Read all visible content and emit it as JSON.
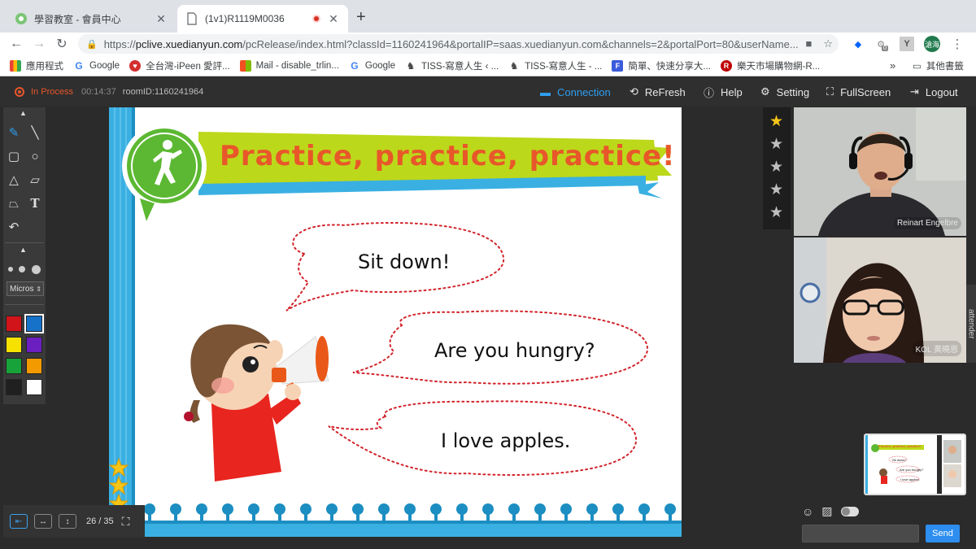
{
  "browser": {
    "tabs": [
      {
        "title": "學習教室 - 會員中心",
        "active": false
      },
      {
        "title": "(1v1)R1119M0036",
        "active": true
      }
    ],
    "url_host": "pclive.xuedianyun.com",
    "url_rest": "/pcRelease/index.html?classId=1160241964&portalIP=saas.xuedianyun.com&channels=2&portalPort=80&userName...",
    "url_scheme": "https://",
    "bookmarks": [
      "應用程式",
      "Google",
      "全台灣-iPeen 愛評...",
      "Mail - disable_trlin...",
      "Google",
      "TISS-寫意人生 ‹ ...",
      "TISS-寫意人生 - ...",
      "簡單、快速分享大...",
      "樂天市場購物網-R..."
    ],
    "bookmarks_more": "»",
    "other_bookmarks": "其他書籤",
    "profile_initials": "滄海",
    "ext_badge": "0"
  },
  "header": {
    "status": "In Process",
    "timer": "00:14:37",
    "room": "roomID:1160241964",
    "connection": "Connection",
    "refresh": "ReFresh",
    "help": "Help",
    "setting": "Setting",
    "fullscreen": "FullScreen",
    "logout": "Logout"
  },
  "toolbar": {
    "font": "Micros",
    "colors": [
      "#d0141a",
      "#1672c9",
      "#f7e100",
      "#6c1fc1",
      "#18a33a",
      "#f39a00",
      "#202020",
      "#ffffff"
    ],
    "selected_color": "#1672c9"
  },
  "slide": {
    "title": "Practice, practice, practice!",
    "bubble1": "Sit down!",
    "bubble2": "Are you hungry?",
    "bubble3": "I love apples."
  },
  "pager": {
    "page": "26 / 35"
  },
  "stars": {
    "total": 5,
    "earned": 1
  },
  "video": {
    "teacher": "Reinart Engelbre",
    "student": "KOL 黃曉恩",
    "side_tab": "attender"
  },
  "chat": {
    "send": "Send"
  },
  "thumbnail": {
    "title": "Practice, practice, practice!",
    "b1": "Sit down!",
    "b2": "Are you hungry?",
    "b3": "I love apples."
  }
}
